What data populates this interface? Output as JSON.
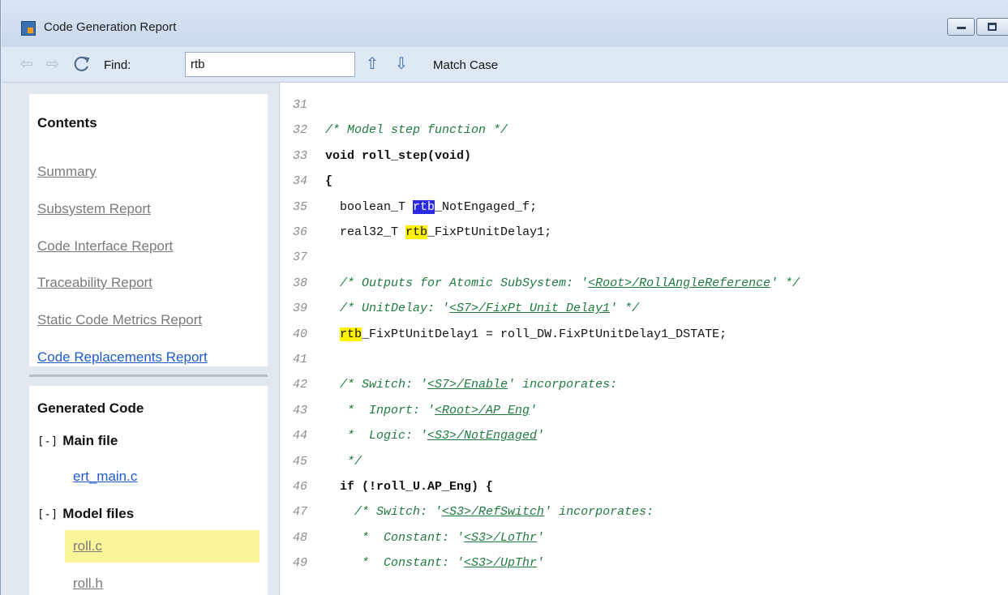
{
  "window": {
    "title": "Code Generation Report"
  },
  "toolbar": {
    "find_label": "Find:",
    "find_value": "rtb",
    "match_case": "Match Case"
  },
  "contents": {
    "heading": "Contents",
    "links": [
      "Summary",
      "Subsystem Report",
      "Code Interface Report",
      "Traceability Report",
      "Static Code Metrics Report",
      "Code Replacements Report"
    ]
  },
  "generated_code": {
    "heading": "Generated Code",
    "groups": [
      {
        "toggle": "[-]",
        "label": "Main file",
        "files": [
          "ert_main.c"
        ]
      },
      {
        "toggle": "[-]",
        "label": "Model files",
        "files": [
          "roll.c",
          "roll.h"
        ]
      }
    ]
  },
  "colors": {
    "link": "#1f5bc6",
    "comment": "#1f7a40",
    "search_highlight": "#fff200",
    "current_match": "#2a2ae0",
    "selected_file": "#fbf59a"
  },
  "code": {
    "lines": [
      {
        "n": "31",
        "parts": []
      },
      {
        "n": "32",
        "parts": [
          {
            "t": "/* Model step function */",
            "c": "cm"
          }
        ]
      },
      {
        "n": "33",
        "parts": [
          {
            "t": "void roll_step(void)",
            "c": "kw"
          }
        ]
      },
      {
        "n": "34",
        "parts": [
          {
            "t": "{",
            "c": "kw"
          }
        ]
      },
      {
        "n": "35",
        "parts": [
          {
            "t": "  boolean_T "
          },
          {
            "t": "rtb",
            "c": "hl-blue"
          },
          {
            "t": "_NotEngaged_f;"
          }
        ]
      },
      {
        "n": "36",
        "parts": [
          {
            "t": "  real32_T "
          },
          {
            "t": "rtb",
            "c": "hl-yellow"
          },
          {
            "t": "_FixPtUnitDelay1;"
          }
        ]
      },
      {
        "n": "37",
        "parts": []
      },
      {
        "n": "38",
        "parts": [
          {
            "t": "  /* Outputs for Atomic SubSystem: '",
            "c": "cm"
          },
          {
            "t": "<Root>/RollAngleReference",
            "c": "cm",
            "link": true
          },
          {
            "t": "' */",
            "c": "cm"
          }
        ]
      },
      {
        "n": "39",
        "parts": [
          {
            "t": "  /* UnitDelay: '",
            "c": "cm"
          },
          {
            "t": "<S7>/FixPt Unit Delay1",
            "c": "cm",
            "link": true
          },
          {
            "t": "' */",
            "c": "cm"
          }
        ]
      },
      {
        "n": "40",
        "parts": [
          {
            "t": "  "
          },
          {
            "t": "rtb",
            "c": "hl-yellow"
          },
          {
            "t": "_FixPtUnitDelay1 = roll_DW.FixPtUnitDelay1_DSTATE;"
          }
        ]
      },
      {
        "n": "41",
        "parts": []
      },
      {
        "n": "42",
        "parts": [
          {
            "t": "  /* Switch: '",
            "c": "cm"
          },
          {
            "t": "<S7>/Enable",
            "c": "cm",
            "link": true
          },
          {
            "t": "' incorporates:",
            "c": "cm"
          }
        ]
      },
      {
        "n": "43",
        "parts": [
          {
            "t": "   *  Inport: '",
            "c": "cm"
          },
          {
            "t": "<Root>/AP_Eng",
            "c": "cm",
            "link": true
          },
          {
            "t": "'",
            "c": "cm"
          }
        ]
      },
      {
        "n": "44",
        "parts": [
          {
            "t": "   *  Logic: '",
            "c": "cm"
          },
          {
            "t": "<S3>/NotEngaged",
            "c": "cm",
            "link": true
          },
          {
            "t": "'",
            "c": "cm"
          }
        ]
      },
      {
        "n": "45",
        "parts": [
          {
            "t": "   */",
            "c": "cm"
          }
        ]
      },
      {
        "n": "46",
        "parts": [
          {
            "t": "  if (!roll_U.AP_Eng) {",
            "c": "kw"
          }
        ]
      },
      {
        "n": "47",
        "parts": [
          {
            "t": "    /* Switch: '",
            "c": "cm"
          },
          {
            "t": "<S3>/RefSwitch",
            "c": "cm",
            "link": true
          },
          {
            "t": "' incorporates:",
            "c": "cm"
          }
        ]
      },
      {
        "n": "48",
        "parts": [
          {
            "t": "     *  Constant: '",
            "c": "cm"
          },
          {
            "t": "<S3>/LoThr",
            "c": "cm",
            "link": true
          },
          {
            "t": "'",
            "c": "cm"
          }
        ]
      },
      {
        "n": "49",
        "parts": [
          {
            "t": "     *  Constant: '",
            "c": "cm"
          },
          {
            "t": "<S3>/UpThr",
            "c": "cm",
            "link": true
          },
          {
            "t": "'",
            "c": "cm"
          }
        ]
      }
    ]
  }
}
